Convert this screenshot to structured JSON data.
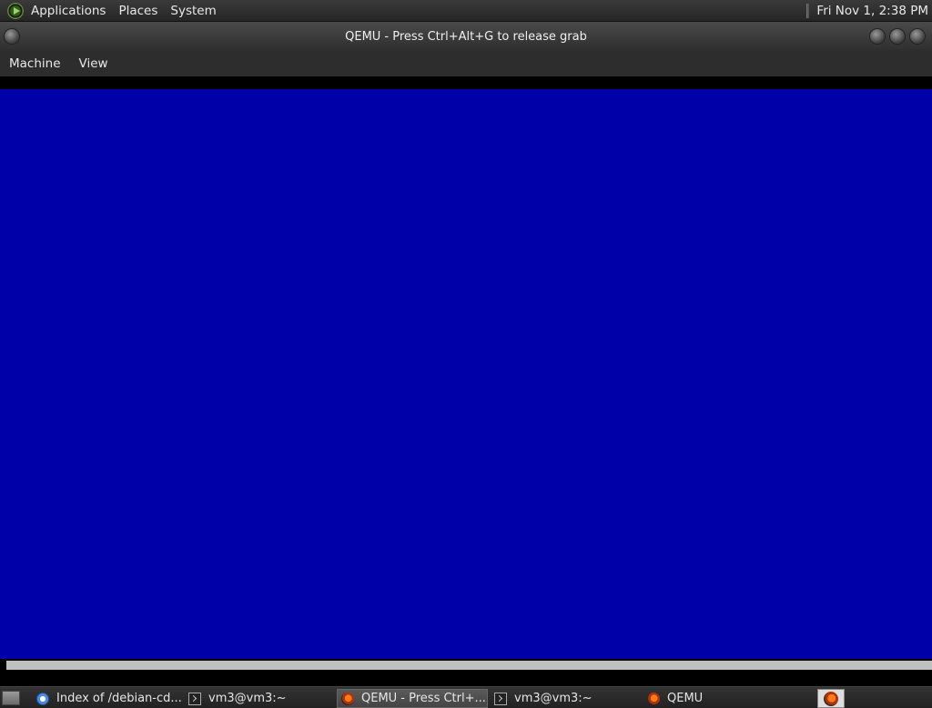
{
  "top_panel": {
    "menu": [
      "Applications",
      "Places",
      "System"
    ],
    "clock": "Fri Nov  1,  2:38 PM"
  },
  "window": {
    "title": "QEMU - Press Ctrl+Alt+G to release grab",
    "menu": [
      "Machine",
      "View"
    ]
  },
  "vm_display": {
    "background": "#0000a8",
    "progress": 1.0
  },
  "taskbar": {
    "tasks": [
      {
        "label": "Index of /debian-cd...",
        "icon": "browser-icon"
      },
      {
        "label": "vm3@vm3:~",
        "icon": "terminal-icon"
      },
      {
        "label": "QEMU - Press Ctrl+...",
        "icon": "qemu-icon",
        "active": true
      },
      {
        "label": "vm3@vm3:~",
        "icon": "terminal-icon"
      },
      {
        "label": "QEMU",
        "icon": "qemu-icon"
      }
    ]
  }
}
